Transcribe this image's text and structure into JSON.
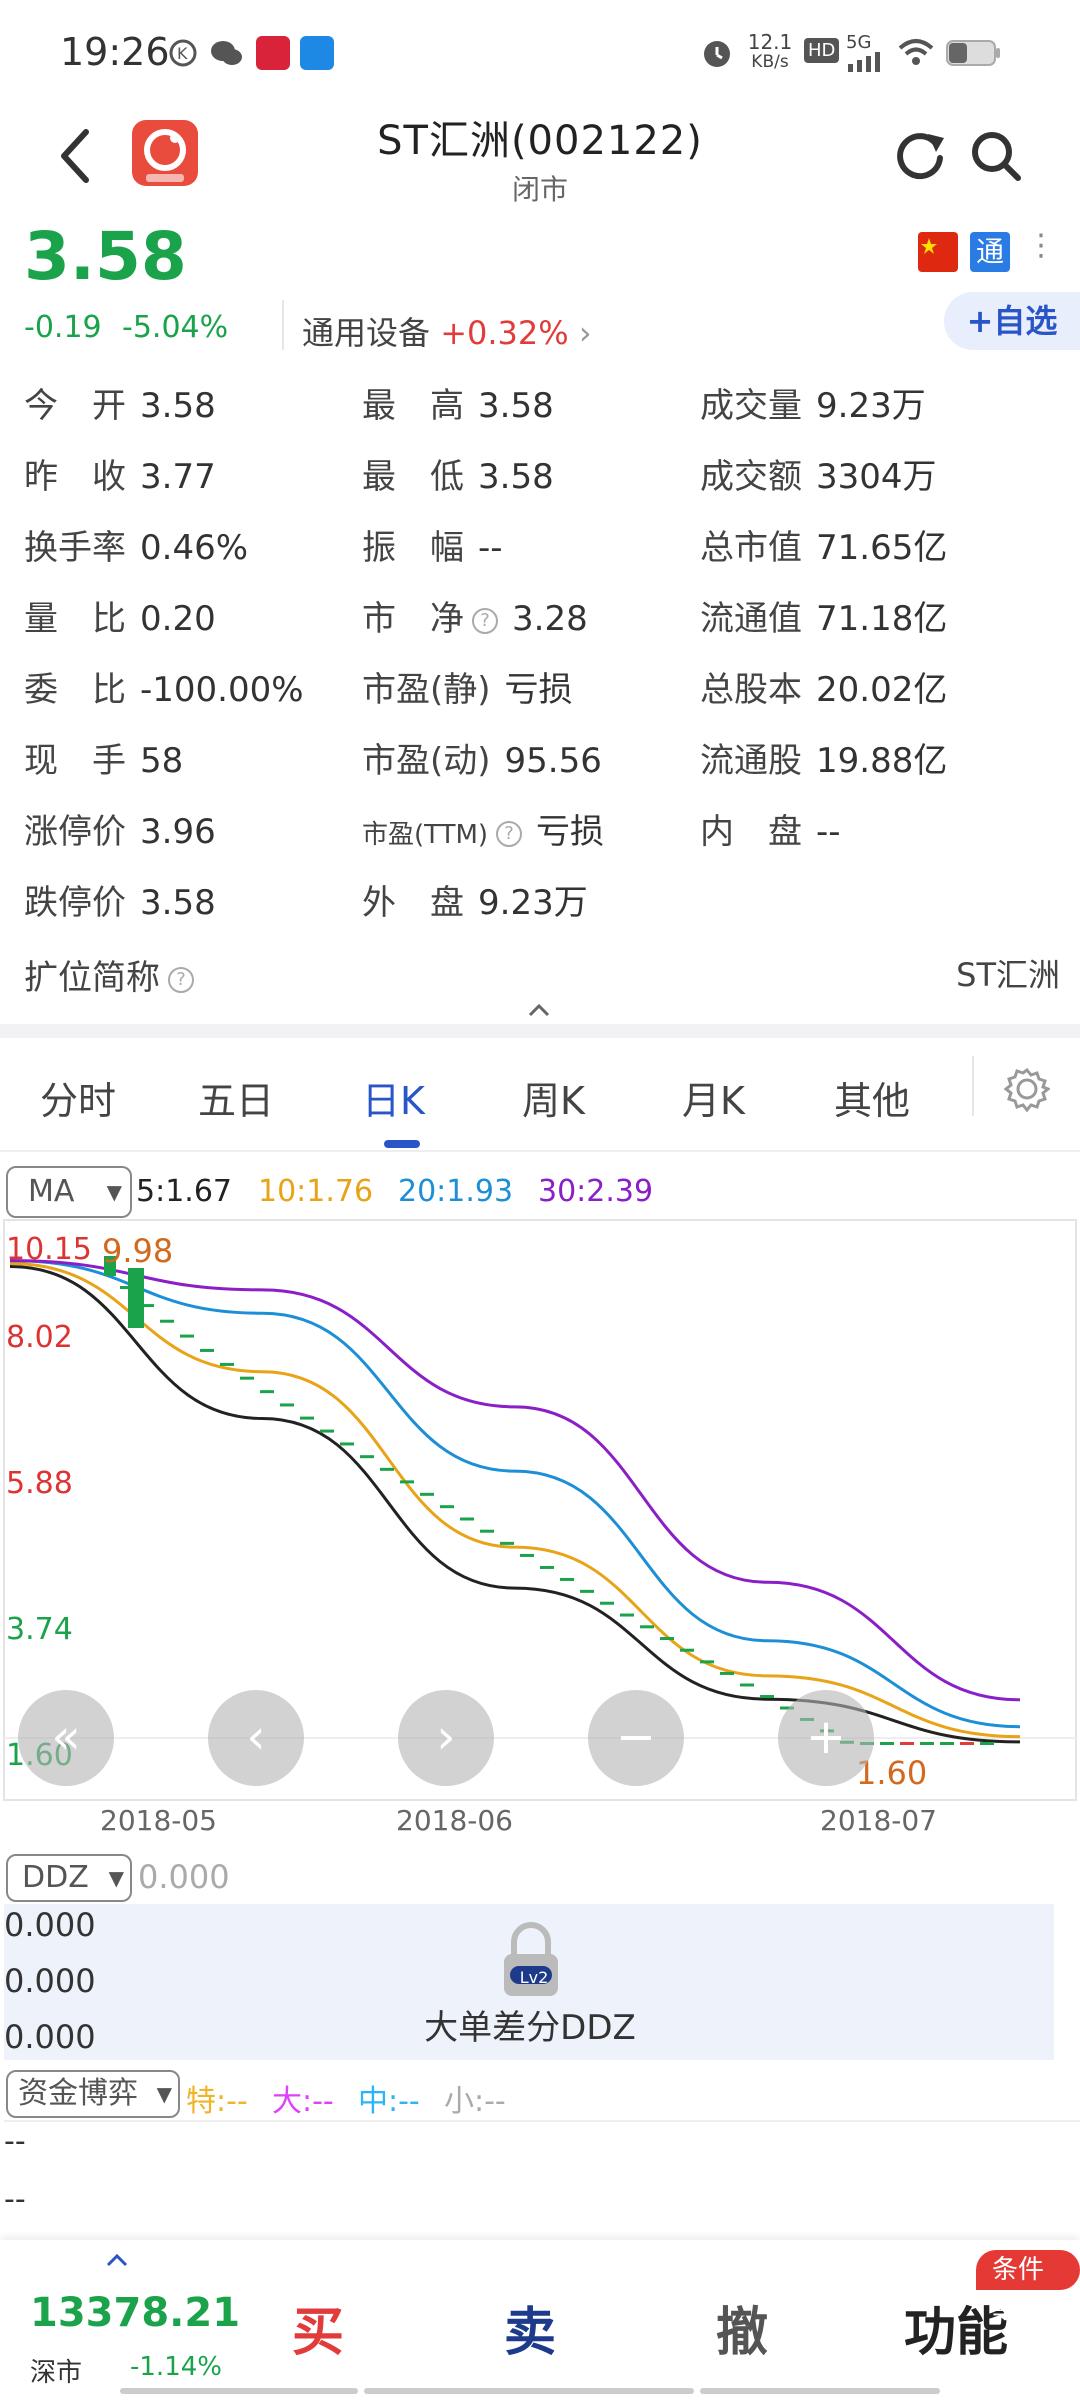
{
  "status_bar": {
    "time": "19:26",
    "net_speed_top": "12.1",
    "net_speed_unit": "KB/s",
    "hd": "HD",
    "signal": "5G"
  },
  "header": {
    "title": "ST汇洲(002122)",
    "subtitle": "闭市"
  },
  "quote": {
    "price": "3.58",
    "change": "-0.19",
    "change_pct": "-5.04%",
    "sector_name": "通用设备",
    "sector_change": "+0.32%",
    "badge_tong": "通",
    "watch_label": "+自选"
  },
  "stats": {
    "col1": [
      {
        "label": "今　开",
        "value": "3.58"
      },
      {
        "label": "昨　收",
        "value": "3.77"
      },
      {
        "label": "换手率",
        "value": "0.46%"
      },
      {
        "label": "量　比",
        "value": "0.20"
      },
      {
        "label": "委　比",
        "value": "-100.00%"
      },
      {
        "label": "现　手",
        "value": "58"
      },
      {
        "label": "涨停价",
        "value": "3.96"
      },
      {
        "label": "跌停价",
        "value": "3.58"
      }
    ],
    "col2": [
      {
        "label": "最　高",
        "value": "3.58"
      },
      {
        "label": "最　低",
        "value": "3.58"
      },
      {
        "label": "振　幅",
        "value": "--"
      },
      {
        "label": "市　净",
        "value": "3.28"
      },
      {
        "label": "市盈(静)",
        "value": "亏损"
      },
      {
        "label": "市盈(动)",
        "value": "95.56"
      },
      {
        "label": "市盈(TTM)",
        "value": "亏损"
      },
      {
        "label": "外　盘",
        "value": "9.23万"
      }
    ],
    "col3": [
      {
        "label": "成交量",
        "value": "9.23万"
      },
      {
        "label": "成交额",
        "value": "3304万"
      },
      {
        "label": "总市值",
        "value": "71.65亿"
      },
      {
        "label": "流通值",
        "value": "71.18亿"
      },
      {
        "label": "总股本",
        "value": "20.02亿"
      },
      {
        "label": "流通股",
        "value": "19.88亿"
      },
      {
        "label": "内　盘",
        "value": "--"
      }
    ],
    "extended_label": "扩位简称",
    "extended_value": "ST汇洲"
  },
  "tabs": [
    "分时",
    "五日",
    "日K",
    "周K",
    "月K",
    "其他"
  ],
  "active_tab": "日K",
  "chart": {
    "ma_select": "MA",
    "ma_legend": [
      {
        "text": "5:1.67",
        "color": "#222222"
      },
      {
        "text": "10:1.76",
        "color": "#e8a317"
      },
      {
        "text": "20:1.93",
        "color": "#1c8fd6"
      },
      {
        "text": "30:2.39",
        "color": "#8a1fc8"
      }
    ],
    "y_labels": [
      "10.15",
      "8.02",
      "5.88",
      "3.74",
      "1.60"
    ],
    "x_labels": [
      "2018-05",
      "2018-06",
      "2018-07"
    ],
    "high_annotation": "9.98",
    "low_annotation": "1.60",
    "nav_buttons": [
      "«",
      "‹",
      "›",
      "−",
      "+"
    ]
  },
  "chart_data": {
    "type": "line",
    "title": "",
    "x": [
      "2018-05",
      "2018-06",
      "2018-07"
    ],
    "ylim": [
      1.6,
      10.15
    ],
    "series": [
      {
        "name": "5",
        "values": [
          9.8,
          7.2,
          4.3,
          2.4,
          1.67
        ]
      },
      {
        "name": "10",
        "values": [
          9.85,
          8.0,
          5.0,
          2.8,
          1.76
        ]
      },
      {
        "name": "20",
        "values": [
          9.9,
          9.0,
          6.3,
          3.4,
          1.93
        ]
      },
      {
        "name": "30",
        "values": [
          9.9,
          9.4,
          7.4,
          4.4,
          2.39
        ]
      }
    ]
  },
  "ddz": {
    "select": "DDZ",
    "value": "0.000",
    "rows": [
      "0.000",
      "0.000",
      "0.000"
    ],
    "lock_label": "Lv2",
    "label": "大单差分DDZ"
  },
  "fund": {
    "select": "资金博弈",
    "items": [
      {
        "text": "特:--",
        "color": "#f0b429"
      },
      {
        "text": "大:--",
        "color": "#e040fb"
      },
      {
        "text": "中:--",
        "color": "#29b6f6"
      },
      {
        "text": "小:--",
        "color": "#aaaaaa"
      }
    ],
    "rows": [
      "--",
      "--"
    ]
  },
  "bottom": {
    "index_value": "13378.21",
    "index_name": "深市",
    "index_change": "-1.14%",
    "buy": "买",
    "sell": "卖",
    "cancel": "撤",
    "func": "功能",
    "cond_badge": "条件单"
  }
}
